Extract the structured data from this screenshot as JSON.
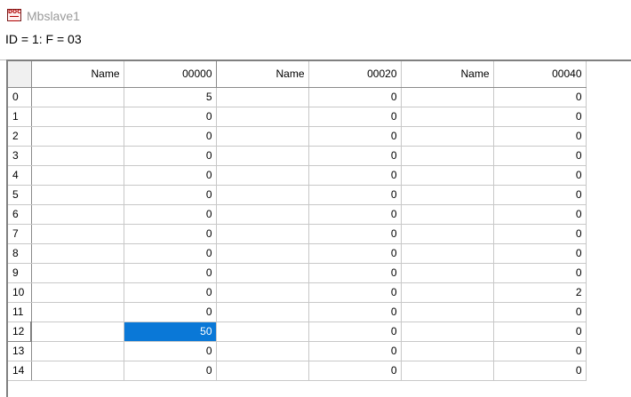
{
  "window": {
    "title": "Mbslave1",
    "icon": "doc-icon"
  },
  "header": {
    "text": "ID = 1: F = 03"
  },
  "grid": {
    "columns": [
      "Name",
      "00000",
      "Name",
      "00020",
      "Name",
      "00040"
    ],
    "rows": [
      {
        "index": "0",
        "values": [
          "5",
          "0",
          "0"
        ]
      },
      {
        "index": "1",
        "values": [
          "0",
          "0",
          "0"
        ]
      },
      {
        "index": "2",
        "values": [
          "0",
          "0",
          "0"
        ]
      },
      {
        "index": "3",
        "values": [
          "0",
          "0",
          "0"
        ]
      },
      {
        "index": "4",
        "values": [
          "0",
          "0",
          "0"
        ]
      },
      {
        "index": "5",
        "values": [
          "0",
          "0",
          "0"
        ]
      },
      {
        "index": "6",
        "values": [
          "0",
          "0",
          "0"
        ]
      },
      {
        "index": "7",
        "values": [
          "0",
          "0",
          "0"
        ]
      },
      {
        "index": "8",
        "values": [
          "0",
          "0",
          "0"
        ]
      },
      {
        "index": "9",
        "values": [
          "0",
          "0",
          "0"
        ]
      },
      {
        "index": "10",
        "values": [
          "0",
          "0",
          "2"
        ]
      },
      {
        "index": "11",
        "values": [
          "0",
          "0",
          "0"
        ]
      },
      {
        "index": "12",
        "values": [
          "50",
          "0",
          "0"
        ]
      },
      {
        "index": "13",
        "values": [
          "0",
          "0",
          "0"
        ]
      },
      {
        "index": "14",
        "values": [
          "0",
          "0",
          "0"
        ]
      }
    ],
    "selected_row": 12,
    "selected_col": 0,
    "selection_color": "#0a78d7"
  }
}
